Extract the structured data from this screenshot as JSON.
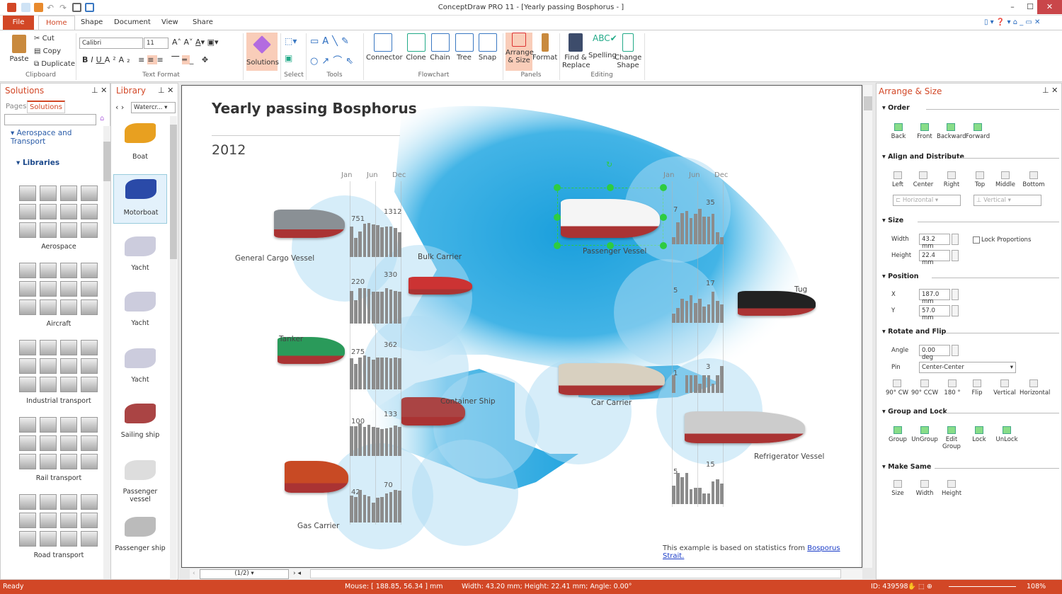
{
  "window": {
    "title": "ConceptDraw PRO 11 - [Yearly passing Bosphorus -  ]"
  },
  "menu": {
    "file": "File",
    "tabs": [
      "Home",
      "Shape",
      "Document",
      "View",
      "Share"
    ]
  },
  "ribbon": {
    "clipboard": {
      "paste": "Paste",
      "cut": "Cut",
      "copy": "Copy",
      "duplicate": "Duplicate",
      "group": "Clipboard"
    },
    "text_format": {
      "font": "Calibri",
      "size": "11",
      "group": "Text Format"
    },
    "solutions": "Solutions",
    "select_group": "Select",
    "tools_group": "Tools",
    "flowchart": {
      "connector": "Connector",
      "clone": "Clone",
      "chain": "Chain",
      "tree": "Tree",
      "snap": "Snap",
      "group": "Flowchart"
    },
    "panels": {
      "arrange": "Arrange\n& Size",
      "format": "Format",
      "group": "Panels"
    },
    "editing": {
      "find": "Find &\nReplace",
      "spelling": "Spelling",
      "change_shape": "Change\nShape",
      "group": "Editing"
    }
  },
  "solutions_panel": {
    "title": "Solutions",
    "tabs": [
      "Pages",
      "Solutions"
    ],
    "search_placeholder": "",
    "tree_root": "Aerospace and Transport",
    "libraries": "Libraries",
    "categories": [
      "Aerospace",
      "Aircraft",
      "Industrial transport",
      "Rail transport",
      "Road transport"
    ]
  },
  "library_panel": {
    "title": "Library",
    "dropdown": "Watercr...",
    "items": [
      "Boat",
      "Motorboat",
      "Yacht",
      "Yacht",
      "Yacht",
      "Sailing ship",
      "Passenger vessel",
      "Passenger ship"
    ]
  },
  "diagram": {
    "title": "Yearly passing Bosphorus",
    "year": "2012",
    "months": [
      "Jan",
      "Jun",
      "Dec"
    ],
    "footer_text": "This example is based on statistics from ",
    "footer_link": "Bosporus Strait.",
    "ships": [
      "General Cargo Vessel",
      "Bulk Carrier",
      "Tanker",
      "Container Ship",
      "Gas Carrier",
      "Passenger Vessel",
      "Tug",
      "Car Carrier",
      "Refrigerator Vessel"
    ]
  },
  "chart_data": [
    {
      "type": "bar",
      "name": "General Cargo Vessel",
      "min_label": "751",
      "max_label": "1312",
      "values": [
        1170,
        751,
        990,
        1280,
        1312,
        1260,
        1220,
        1160,
        1180,
        1180,
        1120,
        970
      ]
    },
    {
      "type": "bar",
      "name": "Bulk Carrier",
      "min_label": "220",
      "max_label": "330",
      "values": [
        305,
        220,
        330,
        330,
        325,
        300,
        300,
        300,
        330,
        315,
        305,
        295
      ]
    },
    {
      "type": "bar",
      "name": "Tanker",
      "min_label": "275",
      "max_label": "362",
      "values": [
        330,
        275,
        340,
        362,
        350,
        320,
        340,
        340,
        340,
        335,
        342,
        330
      ]
    },
    {
      "type": "bar",
      "name": "Container Ship",
      "min_label": "100",
      "max_label": "133",
      "values": [
        120,
        120,
        133,
        118,
        128,
        118,
        116,
        110,
        112,
        115,
        125,
        118
      ]
    },
    {
      "type": "bar",
      "name": "Gas Carrier",
      "min_label": "42",
      "max_label": "70",
      "values": [
        58,
        55,
        70,
        60,
        57,
        42,
        54,
        55,
        62,
        66,
        70,
        68
      ]
    },
    {
      "type": "bar",
      "name": "Passenger Vessel",
      "min_label": "7",
      "max_label": "35",
      "values": [
        7,
        22,
        31,
        33,
        26,
        30,
        35,
        27,
        27,
        30,
        12,
        7
      ]
    },
    {
      "type": "bar",
      "name": "Tug",
      "min_label": "5",
      "max_label": "17",
      "values": [
        5,
        8,
        13,
        12,
        15,
        11,
        13,
        9,
        10,
        17,
        12,
        10
      ]
    },
    {
      "type": "bar",
      "name": "Car Carrier",
      "min_label": "1",
      "max_label": "3",
      "values": [
        2,
        0,
        0,
        2,
        2,
        2,
        1,
        2,
        2,
        1,
        2,
        3
      ]
    },
    {
      "type": "bar",
      "name": "Refrigerator Vessel",
      "min_label": "5",
      "max_label": "15",
      "values": [
        9,
        15,
        13,
        15,
        7,
        8,
        8,
        5,
        5,
        11,
        12,
        10
      ]
    }
  ],
  "arrange_panel": {
    "title": "Arrange & Size",
    "order": {
      "label": "Order",
      "buttons": [
        "Back",
        "Front",
        "Backward",
        "Forward"
      ]
    },
    "align": {
      "label": "Align and Distribute",
      "buttons": [
        "Left",
        "Center",
        "Right",
        "Top",
        "Middle",
        "Bottom"
      ],
      "horizontal": "Horizontal",
      "vertical": "Vertical"
    },
    "size": {
      "label": "Size",
      "width_label": "Width",
      "width": "43.2 mm",
      "height_label": "Height",
      "height": "22.4 mm",
      "lock": "Lock Proportions"
    },
    "position": {
      "label": "Position",
      "x_label": "X",
      "x": "187.0 mm",
      "y_label": "Y",
      "y": "57.0 mm"
    },
    "rotate": {
      "label": "Rotate and Flip",
      "angle_label": "Angle",
      "angle": "0.00 deg",
      "pin_label": "Pin",
      "pin": "Center-Center",
      "buttons": [
        "90° CW",
        "90° CCW",
        "180 °",
        "Flip",
        "Vertical",
        "Horizontal"
      ]
    },
    "group": {
      "label": "Group and Lock",
      "buttons": [
        "Group",
        "UnGroup",
        "Edit\nGroup",
        "Lock",
        "UnLock"
      ]
    },
    "same": {
      "label": "Make Same",
      "buttons": [
        "Size",
        "Width",
        "Height"
      ]
    }
  },
  "page_nav": {
    "page": "(1/2)"
  },
  "status": {
    "ready": "Ready",
    "mouse": "Mouse: [ 188.85, 56.34 ] mm",
    "dims": "Width: 43.20 mm;  Height: 22.41 mm;  Angle: 0.00°",
    "id": "ID: 439598",
    "zoom": "108%"
  },
  "colors": {
    "accent": "#d24726",
    "water": "#29a8e0",
    "bars": "#8c8c8c",
    "selection": "#2ecc40"
  }
}
